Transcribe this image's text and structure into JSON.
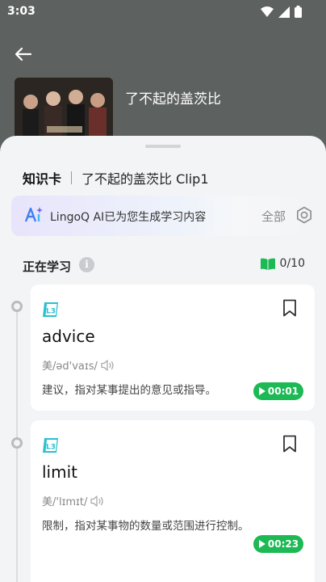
{
  "status": {
    "time": "3:03"
  },
  "video": {
    "title": "了不起的盖茨比"
  },
  "sheet": {
    "title": "知识卡",
    "subtitle": "了不起的盖茨比 Clip1",
    "ai_banner": {
      "text": "LingoQ AI已为您生成学习内容",
      "all_label": "全部"
    },
    "learning": {
      "label": "正在学习",
      "progress": "0/10"
    },
    "cards": [
      {
        "level": "L3",
        "word": "advice",
        "phonetic": "美/əd'vaɪs/",
        "definition": "建议，指对某事提出的意见或指导。",
        "time": "00:01"
      },
      {
        "level": "L3",
        "word": "limit",
        "phonetic": "美/'lɪmɪt/",
        "definition": "限制，指对某事物的数量或范围进行控制。",
        "time": "00:23"
      }
    ]
  },
  "colors": {
    "accent_green": "#1db954",
    "level_teal": "#2bbfd0",
    "sheet_bg": "#f3f4f6"
  }
}
